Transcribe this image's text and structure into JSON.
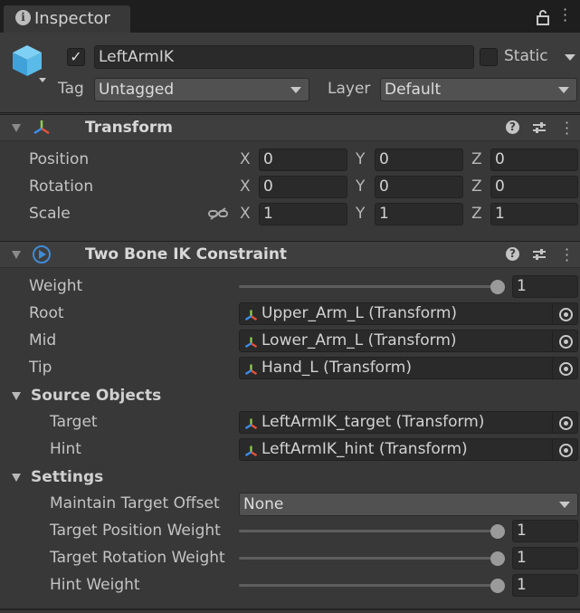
{
  "window": {
    "tab_label": "Inspector",
    "tab_icon": "info-icon"
  },
  "gameobject": {
    "name": "LeftArmIK",
    "active_checked": true,
    "static_label": "Static",
    "static_checked": false,
    "tag_label": "Tag",
    "tag_value": "Untagged",
    "layer_label": "Layer",
    "layer_value": "Default"
  },
  "transform": {
    "title": "Transform",
    "rows": [
      {
        "label": "Position",
        "x": "0",
        "y": "0",
        "z": "0"
      },
      {
        "label": "Rotation",
        "x": "0",
        "y": "0",
        "z": "0"
      },
      {
        "label": "Scale",
        "x": "1",
        "y": "1",
        "z": "1"
      }
    ],
    "axis_x": "X",
    "axis_y": "Y",
    "axis_z": "Z"
  },
  "ik": {
    "title": "Two Bone IK Constraint",
    "weight_label": "Weight",
    "weight_value": "1",
    "root_label": "Root",
    "root_value": "Upper_Arm_L (Transform)",
    "mid_label": "Mid",
    "mid_value": "Lower_Arm_L (Transform)",
    "tip_label": "Tip",
    "tip_value": "Hand_L (Transform)",
    "source_objects_label": "Source Objects",
    "target_label": "Target",
    "target_value": "LeftArmIK_target (Transform)",
    "hint_label": "Hint",
    "hint_value": "LeftArmIK_hint (Transform)",
    "settings_label": "Settings",
    "maintain_offset_label": "Maintain Target Offset",
    "maintain_offset_value": "None",
    "target_pos_weight_label": "Target Position Weight",
    "target_pos_weight_value": "1",
    "target_rot_weight_label": "Target Rotation Weight",
    "target_rot_weight_value": "1",
    "hint_weight_label": "Hint Weight",
    "hint_weight_value": "1"
  },
  "colors": {
    "background": "#383838",
    "field": "#2a2a2a",
    "header": "#3e3e3e"
  }
}
